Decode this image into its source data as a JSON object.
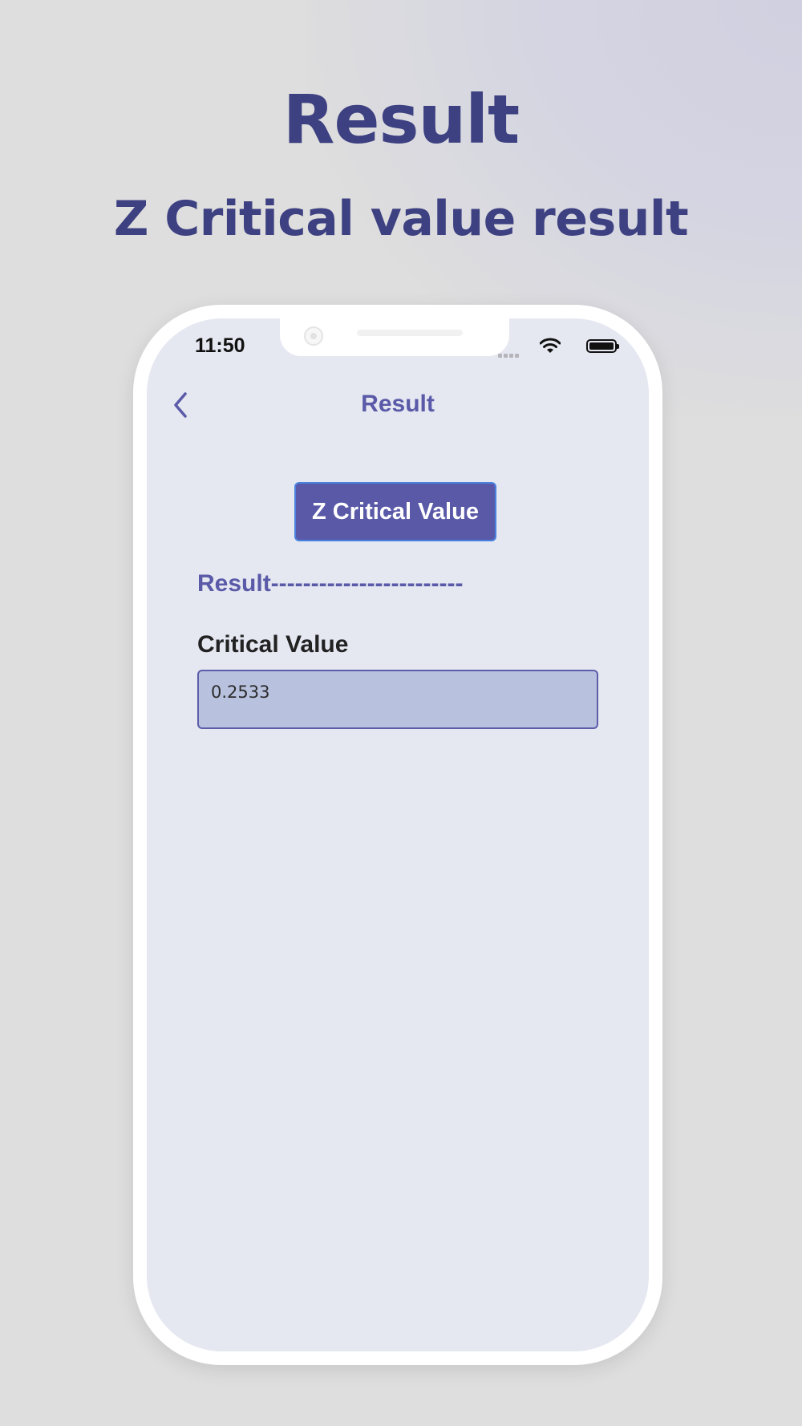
{
  "promo": {
    "title": "Result",
    "subtitle": "Z Critical value result"
  },
  "status_bar": {
    "time": "11:50",
    "icons": [
      "signal-icon",
      "wifi-icon",
      "battery-icon"
    ]
  },
  "nav": {
    "back_icon": "chevron-left-icon",
    "title": "Result"
  },
  "main": {
    "button_label": "Z Critical Value",
    "result_heading": "Result------------------------",
    "field_label": "Critical Value",
    "field_value": "0.2533"
  },
  "colors": {
    "accent": "#5959a8",
    "promo_text": "#3d4081",
    "screen_bg": "#e5e8f1",
    "field_bg": "#b8c1de"
  }
}
